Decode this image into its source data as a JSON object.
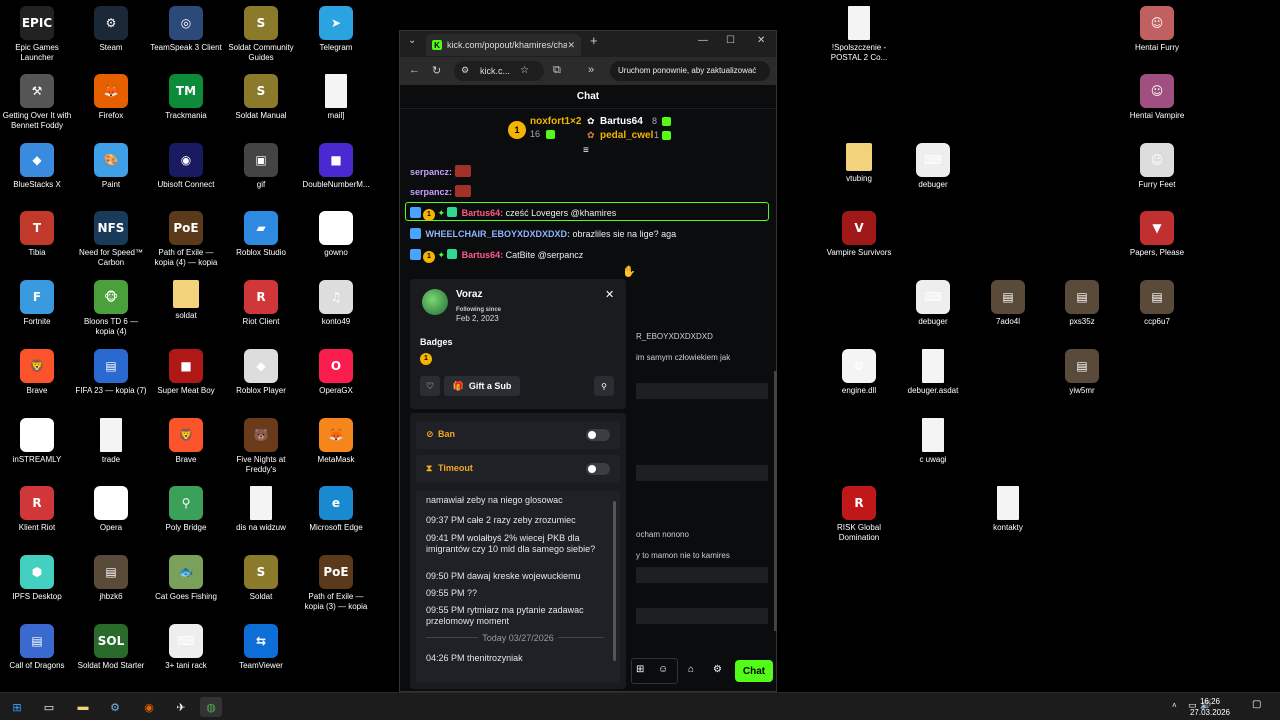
{
  "desktop": {
    "icons": [
      {
        "label": "Epic Games Launcher",
        "color": "#222222",
        "glyph": "EPIC",
        "icon": "epic-games-icon"
      },
      {
        "label": "Steam",
        "color": "#1b2838",
        "glyph": "⚙",
        "icon": "steam-icon"
      },
      {
        "label": "TeamSpeak 3 Client",
        "color": "#2b4a7a",
        "glyph": "◎",
        "icon": "teamspeak-icon"
      },
      {
        "label": "Soldat Community Guides",
        "color": "#8a7a2a",
        "glyph": "S",
        "icon": "soldat-icon"
      },
      {
        "label": "Telegram",
        "color": "#2aa3e0",
        "glyph": "➤",
        "icon": "telegram-icon"
      },
      {
        "label": "Getting Over It with Bennett Foddy",
        "color": "#555555",
        "glyph": "⚒",
        "icon": "getting-over-it-icon"
      },
      {
        "label": "Firefox",
        "color": "#e66000",
        "glyph": "🦊",
        "icon": "firefox-icon"
      },
      {
        "label": "Trackmania",
        "color": "#0c8b3a",
        "glyph": "TM",
        "icon": "trackmania-icon"
      },
      {
        "label": "Soldat Manual",
        "color": "#8a7a2a",
        "glyph": "S",
        "icon": "soldat-manual-icon"
      },
      {
        "label": "mail]",
        "color": "#f4f4f4",
        "glyph": "",
        "icon": "document-icon"
      },
      {
        "label": "BlueStacks X",
        "color": "#3a8be0",
        "glyph": "◆",
        "icon": "bluestacks-icon"
      },
      {
        "label": "Paint",
        "color": "#3fa0e8",
        "glyph": "🎨",
        "icon": "paint-icon"
      },
      {
        "label": "Ubisoft Connect",
        "color": "#1a1a60",
        "glyph": "◉",
        "icon": "ubisoft-icon"
      },
      {
        "label": "gif",
        "color": "#444444",
        "glyph": "▣",
        "icon": "gif-icon"
      },
      {
        "label": "DoubleNumberM...",
        "color": "#4a2ad0",
        "glyph": "■",
        "icon": "doublenumber-icon"
      },
      {
        "label": "Tibia",
        "color": "#c0392b",
        "glyph": "T",
        "icon": "tibia-icon"
      },
      {
        "label": "Need for Speed™ Carbon",
        "color": "#1a3a5a",
        "glyph": "NFS",
        "icon": "nfs-icon"
      },
      {
        "label": "Path of Exile — kopia (4) — kopia",
        "color": "#5a3a1a",
        "glyph": "PoE",
        "icon": "poe-icon"
      },
      {
        "label": "Roblox Studio",
        "color": "#2d8ae0",
        "glyph": "▰",
        "icon": "roblox-studio-icon"
      },
      {
        "label": "gowno",
        "color": "#ffffff",
        "glyph": "▬",
        "icon": "gowno-icon"
      },
      {
        "label": "Fortnite",
        "color": "#3a9ae0",
        "glyph": "F",
        "icon": "fortnite-icon"
      },
      {
        "label": "Bloons TD 6 — kopia (4)",
        "color": "#4aa03a",
        "glyph": "🐵",
        "icon": "bloons-icon"
      },
      {
        "label": "soldat",
        "color": "#f2d27a",
        "glyph": "",
        "icon": "folder-icon"
      },
      {
        "label": "Riot Client",
        "color": "#d13639",
        "glyph": "R",
        "icon": "riot-icon"
      },
      {
        "label": "konto49",
        "color": "#dddddd",
        "glyph": "♫",
        "icon": "konto-icon"
      },
      {
        "label": "Brave",
        "color": "#fb542b",
        "glyph": "🦁",
        "icon": "brave-icon"
      },
      {
        "label": "FIFA 23 — kopia (7)",
        "color": "#2a6ad0",
        "glyph": "▤",
        "icon": "fifa-icon"
      },
      {
        "label": "Super Meat Boy",
        "color": "#b01818",
        "glyph": "■",
        "icon": "meatboy-icon"
      },
      {
        "label": "Roblox Player",
        "color": "#dddddd",
        "glyph": "◆",
        "icon": "roblox-player-icon"
      },
      {
        "label": "OperaGX",
        "color": "#fa1e4e",
        "glyph": "O",
        "icon": "operagx-icon"
      },
      {
        "label": "inSTREAMLY",
        "color": "#ffffff",
        "glyph": "▚",
        "icon": "instreamly-icon"
      },
      {
        "label": "trade",
        "color": "#f4f4f4",
        "glyph": "",
        "icon": "document-icon"
      },
      {
        "label": "Brave",
        "color": "#fb542b",
        "glyph": "🦁",
        "icon": "brave-icon-2"
      },
      {
        "label": "Five Nights at Freddy's",
        "color": "#6a3a1a",
        "glyph": "🐻",
        "icon": "fnaf-icon"
      },
      {
        "label": "MetaMask",
        "color": "#f6851b",
        "glyph": "🦊",
        "icon": "metamask-icon"
      },
      {
        "label": "Klient Riot",
        "color": "#d13639",
        "glyph": "R",
        "icon": "klient-riot-icon"
      },
      {
        "label": "Opera",
        "color": "#ffffff",
        "glyph": "O",
        "icon": "opera-icon"
      },
      {
        "label": "Poly Bridge",
        "color": "#3aa05a",
        "glyph": "⚲",
        "icon": "polybridge-icon"
      },
      {
        "label": "dis na widzuw",
        "color": "#f4f4f4",
        "glyph": "",
        "icon": "document-icon"
      },
      {
        "label": "Microsoft Edge",
        "color": "#1a8ad0",
        "glyph": "e",
        "icon": "edge-icon"
      },
      {
        "label": "IPFS Desktop",
        "color": "#44d0c0",
        "glyph": "⬢",
        "icon": "ipfs-icon"
      },
      {
        "label": "jhbzk6",
        "color": "#5a4a3a",
        "glyph": "▤",
        "icon": "image-icon"
      },
      {
        "label": "Cat Goes Fishing",
        "color": "#7aa05a",
        "glyph": "🐟",
        "icon": "catfishing-icon"
      },
      {
        "label": "Soldat",
        "color": "#8a7a2a",
        "glyph": "S",
        "icon": "soldat-icon-2"
      },
      {
        "label": "Path of Exile — kopia (3) — kopia",
        "color": "#5a3a1a",
        "glyph": "PoE",
        "icon": "poe-icon-2"
      },
      {
        "label": "Call of Dragons",
        "color": "#3a6ad0",
        "glyph": "▤",
        "icon": "callofdragons-icon"
      },
      {
        "label": "Soldat Mod Starter",
        "color": "#2a6a2a",
        "glyph": "SOL",
        "icon": "soldat-mod-icon"
      },
      {
        "label": "3+ tani rack",
        "color": "#eeeeee",
        "glyph": "⌨",
        "icon": "keyboard-icon"
      },
      {
        "label": "TeamViewer",
        "color": "#0e6ed8",
        "glyph": "⇆",
        "icon": "teamviewer-icon"
      }
    ],
    "right_icons": [
      {
        "label": "!Spolszczenie - POSTAL 2 Co...",
        "color": "#f4f4f4",
        "glyph": "",
        "icon": "document-icon"
      },
      {
        "label": "Hentai Furry",
        "color": "#c06060",
        "glyph": "☺",
        "icon": "game-icon"
      },
      {
        "label": "Hentai Vampire",
        "color": "#a05080",
        "glyph": "☺",
        "icon": "game-icon"
      },
      {
        "label": "vtubing",
        "color": "#f2d27a",
        "glyph": "",
        "icon": "folder-icon"
      },
      {
        "label": "debuger",
        "color": "#eeeeee",
        "glyph": "⌨",
        "icon": "keyboard-icon"
      },
      {
        "label": "Furry Feet",
        "color": "#dddddd",
        "glyph": "☺",
        "icon": "game-icon"
      },
      {
        "label": "Vampire Survivors",
        "color": "#a01818",
        "glyph": "V",
        "icon": "vampire-icon"
      },
      {
        "label": "Papers, Please",
        "color": "#c03030",
        "glyph": "▼",
        "icon": "papers-please-icon"
      },
      {
        "label": "debuger",
        "color": "#eeeeee",
        "glyph": "⌨",
        "icon": "keyboard-icon"
      },
      {
        "label": "7ado4l",
        "color": "#5a4a3a",
        "glyph": "▤",
        "icon": "image-icon"
      },
      {
        "label": "pxs35z",
        "color": "#5a4a3a",
        "glyph": "▤",
        "icon": "image-icon"
      },
      {
        "label": "ccp6u7",
        "color": "#5a4a3a",
        "glyph": "▤",
        "icon": "image-icon"
      },
      {
        "label": "engine.dll",
        "color": "#f4f4f4",
        "glyph": "⚙",
        "icon": "dll-icon"
      },
      {
        "label": "debuger.asdat",
        "color": "#f4f4f4",
        "glyph": "",
        "icon": "document-icon"
      },
      {
        "label": "yiw5mr",
        "color": "#5a4a3a",
        "glyph": "▤",
        "icon": "image-icon"
      },
      {
        "label": "c uwagi",
        "color": "#f4f4f4",
        "glyph": "",
        "icon": "document-icon"
      },
      {
        "label": "RISK Global Domination",
        "color": "#c01818",
        "glyph": "R",
        "icon": "risk-icon"
      },
      {
        "label": "kontakty",
        "color": "#f4f4f4",
        "glyph": "",
        "icon": "document-icon"
      }
    ]
  },
  "taskbar": {
    "time": "16:26",
    "date": "27.03.2026"
  },
  "browser": {
    "tab_title": "kick.com/popout/khamires/chat",
    "url": "kick.c...",
    "update_button": "Uruchom ponownie, aby zaktualizować",
    "chat_title": "Chat",
    "leaderboard": [
      {
        "name": "noxfort1×2",
        "count": "16"
      },
      {
        "name": "Bartus64",
        "count": "8"
      },
      {
        "name": "pedal_cwel",
        "count": "1"
      }
    ],
    "messages": [
      {
        "user": "serpancz:",
        "text": "",
        "color": "#c6a0ff"
      },
      {
        "user": "serpancz:",
        "text": "",
        "color": "#c6a0ff"
      },
      {
        "user": "Bartus64:",
        "text": " cześć Lovegers @khamires",
        "color": "#ff5c8a"
      },
      {
        "user": "WHEELCHAIR_EBOYXDXDXDXD:",
        "text": " obrazliles sie na lige? aga",
        "color": "#8fb4ff"
      },
      {
        "user": "Bartus64:",
        "text": " CatBite @serpancz",
        "color": "#ff5c8a"
      }
    ],
    "bg_fragments": [
      "R_EBOYXDXDXDXD",
      "im samym człowiekiem jak",
      "ocham nonono",
      "y to mamon nie to kamires"
    ],
    "input_chat_button": "Chat"
  },
  "usercard": {
    "username": "Voraz",
    "following_label": "Following since",
    "following_date": "Feb 2, 2023",
    "badges_label": "Badges",
    "gift_button": "Gift a Sub",
    "ban_label": "Ban",
    "timeout_label": "Timeout",
    "history": [
      {
        "time": "",
        "text": "namawiał zeby na niego glosowac"
      },
      {
        "time": "09:37 PM",
        "text": "całe 2 razy zeby zrozumiec"
      },
      {
        "time": "09:41 PM",
        "text": "wolałbyś 2% wiecej PKB dla imigrantów czy 10 mld dla samego siebie?"
      },
      {
        "time": "09:50 PM",
        "text": "dawaj kreske wojewuckiemu"
      },
      {
        "time": "09:55 PM",
        "text": "??"
      },
      {
        "time": "09:55 PM",
        "text": "rytmiarz ma pytanie zadawac przelomowy moment"
      }
    ],
    "today_divider": "Today 03/27/2026",
    "last": {
      "time": "04:26 PM",
      "text": "thenitrozyniak"
    }
  }
}
